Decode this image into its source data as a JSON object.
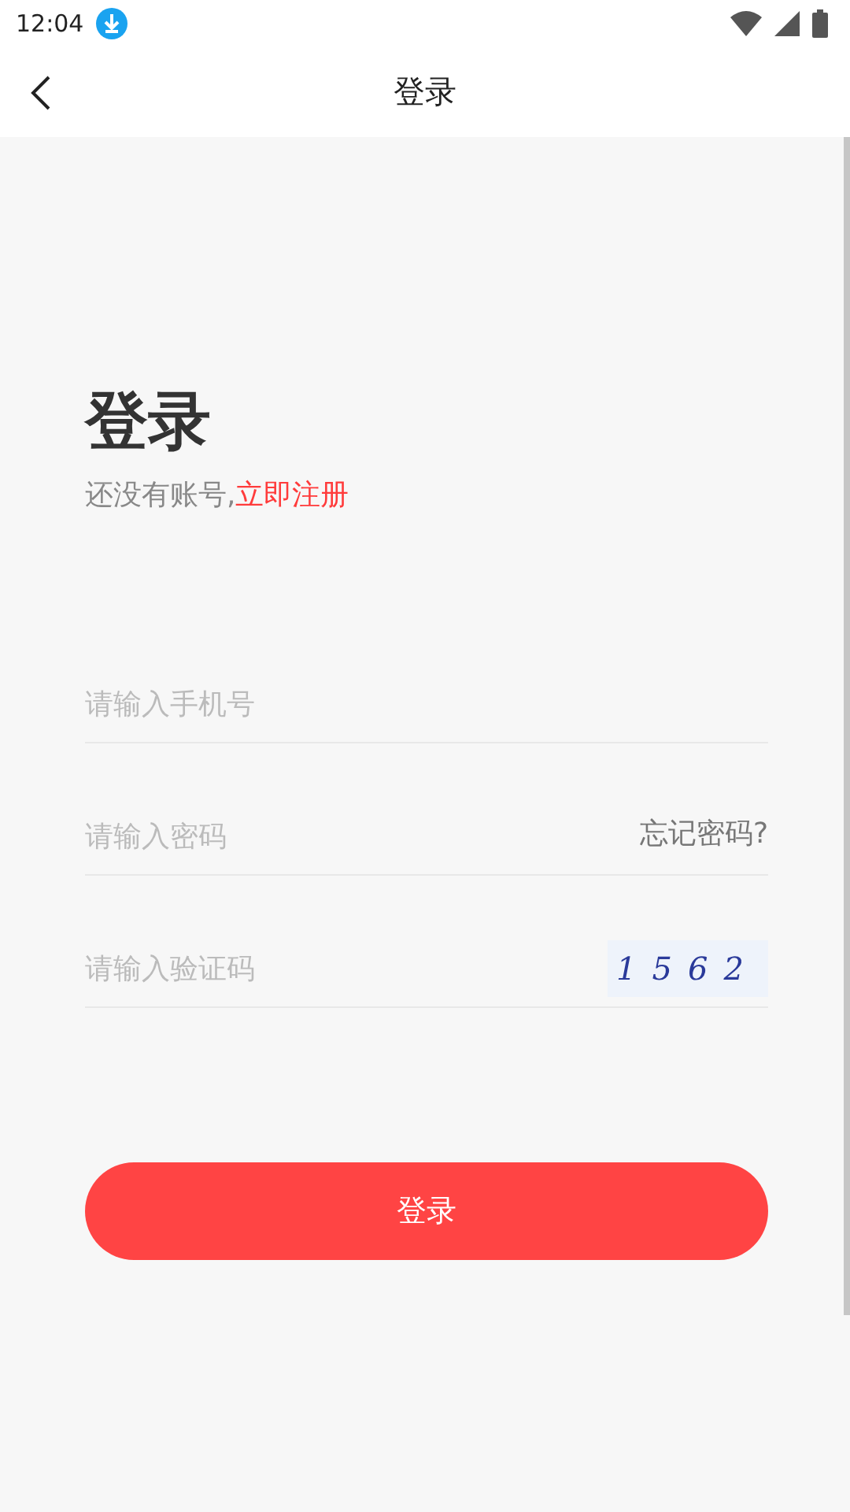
{
  "status_bar": {
    "time": "12:04"
  },
  "header": {
    "title": "登录"
  },
  "heading": "登录",
  "subtitle": {
    "prompt": "还没有账号,",
    "link": "立即注册"
  },
  "fields": [
    {
      "kind": "plain",
      "placeholder": "请输入手机号"
    },
    {
      "kind": "link",
      "placeholder": "请输入密码",
      "action": "忘记密码?"
    },
    {
      "kind": "captcha",
      "placeholder": "请输入验证码",
      "code": "1562"
    }
  ],
  "submit": "登录"
}
